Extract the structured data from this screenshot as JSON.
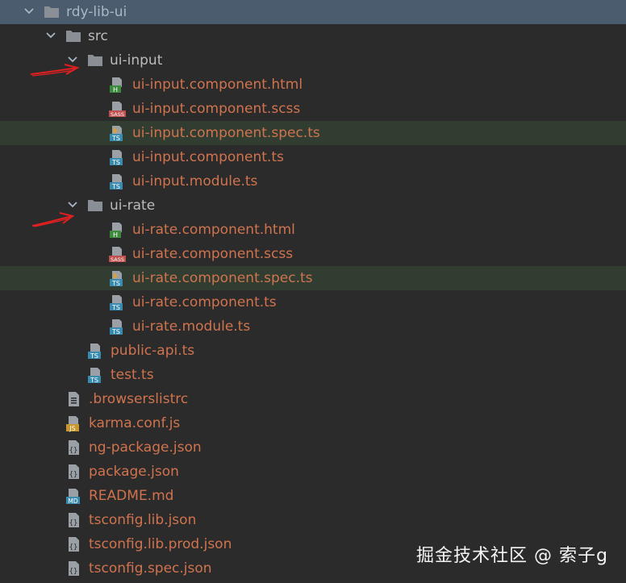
{
  "tree": {
    "root": "rdy-lib-ui",
    "src": "src",
    "ui_input": {
      "folder": "ui-input",
      "files": [
        {
          "name": "ui-input.component.html",
          "icon": "html-file-icon"
        },
        {
          "name": "ui-input.component.scss",
          "icon": "sass-file-icon"
        },
        {
          "name": "ui-input.component.spec.ts",
          "icon": "ts-spec-file-icon"
        },
        {
          "name": "ui-input.component.ts",
          "icon": "ts-file-icon"
        },
        {
          "name": "ui-input.module.ts",
          "icon": "ts-file-icon"
        }
      ]
    },
    "ui_rate": {
      "folder": "ui-rate",
      "files": [
        {
          "name": "ui-rate.component.html",
          "icon": "html-file-icon"
        },
        {
          "name": "ui-rate.component.scss",
          "icon": "sass-file-icon"
        },
        {
          "name": "ui-rate.component.spec.ts",
          "icon": "ts-spec-file-icon"
        },
        {
          "name": "ui-rate.component.ts",
          "icon": "ts-file-icon"
        },
        {
          "name": "ui-rate.module.ts",
          "icon": "ts-file-icon"
        }
      ]
    },
    "src_files": [
      {
        "name": "public-api.ts",
        "icon": "ts-file-icon"
      },
      {
        "name": "test.ts",
        "icon": "ts-file-icon"
      }
    ],
    "root_files": [
      {
        "name": ".browserslistrc",
        "icon": "text-file-icon"
      },
      {
        "name": "karma.conf.js",
        "icon": "js-file-icon"
      },
      {
        "name": "ng-package.json",
        "icon": "json-file-icon"
      },
      {
        "name": "package.json",
        "icon": "json-file-icon"
      },
      {
        "name": "README.md",
        "icon": "md-file-icon"
      },
      {
        "name": "tsconfig.lib.json",
        "icon": "json-file-icon"
      },
      {
        "name": "tsconfig.lib.prod.json",
        "icon": "json-file-icon"
      },
      {
        "name": "tsconfig.spec.json",
        "icon": "json-file-icon"
      }
    ]
  },
  "icon_badges": {
    "html": "H",
    "sass": "SASS",
    "ts": "TS",
    "js": "JS",
    "md": "MD",
    "json": "{}"
  },
  "colors": {
    "background": "#2b2b2b",
    "selected_row": "#4b5c6e",
    "spec_row": "#323d32",
    "file_text": "#d0734e",
    "folder_text": "#bbbbbb",
    "arrow": "#e02020"
  },
  "watermark": "掘金技术社区 @ 索子g"
}
